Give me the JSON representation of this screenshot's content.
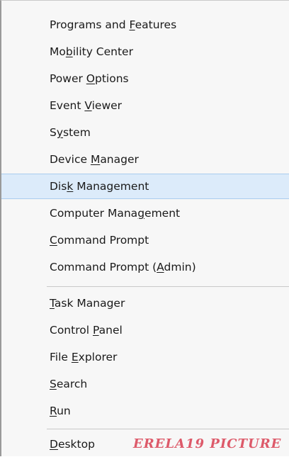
{
  "menu": {
    "items": [
      {
        "pre": "Programs and ",
        "key": "F",
        "post": "eatures"
      },
      {
        "pre": "Mo",
        "key": "b",
        "post": "ility Center"
      },
      {
        "pre": "Power ",
        "key": "O",
        "post": "ptions"
      },
      {
        "pre": "Event ",
        "key": "V",
        "post": "iewer"
      },
      {
        "pre": "S",
        "key": "y",
        "post": "stem"
      },
      {
        "pre": "Device ",
        "key": "M",
        "post": "anager"
      },
      {
        "pre": "Dis",
        "key": "k",
        "post": " Management",
        "selected": true
      },
      {
        "pre": "Computer Mana",
        "key": "g",
        "post": "ement"
      },
      {
        "pre": "",
        "key": "C",
        "post": "ommand Prompt"
      },
      {
        "pre": "Command Prompt (",
        "key": "A",
        "post": "dmin)"
      },
      {
        "pre": "",
        "key": "T",
        "post": "ask Manager"
      },
      {
        "pre": "Control ",
        "key": "P",
        "post": "anel"
      },
      {
        "pre": "File ",
        "key": "E",
        "post": "xplorer"
      },
      {
        "pre": "",
        "key": "S",
        "post": "earch"
      },
      {
        "pre": "",
        "key": "R",
        "post": "un"
      },
      {
        "pre": "",
        "key": "D",
        "post": "esktop"
      }
    ]
  },
  "watermark": "ERELA19 PICTURE",
  "colors": {
    "selected_bg": "#dcebfa",
    "selected_border": "#aacdee",
    "menu_bg": "#f7f7f7",
    "watermark": "#dd5a6a"
  }
}
